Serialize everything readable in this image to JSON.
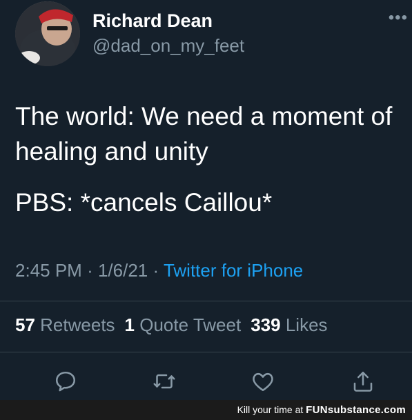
{
  "user": {
    "name": "Richard Dean",
    "handle": "@dad_on_my_feet",
    "more_label": "•••"
  },
  "tweet": {
    "lines": [
      "The world: We need a moment of healing and unity",
      "PBS: *cancels Caillou*"
    ],
    "time": "2:45 PM",
    "separator": "·",
    "date": "1/6/21",
    "source": "Twitter for iPhone"
  },
  "stats": {
    "retweets_count": "57",
    "retweets_label": "Retweets",
    "quotes_count": "1",
    "quotes_label": "Quote Tweet",
    "likes_count": "339",
    "likes_label": "Likes"
  },
  "actions": {
    "icons": [
      "reply-icon",
      "retweet-icon",
      "like-icon",
      "share-icon"
    ]
  },
  "footer": {
    "prefix": "Kill your time at",
    "brand": "FUNsubstance.com"
  },
  "colors": {
    "background": "#15202b",
    "secondary_text": "#8899a6",
    "link": "#1da1f2",
    "divider": "#38444d"
  }
}
